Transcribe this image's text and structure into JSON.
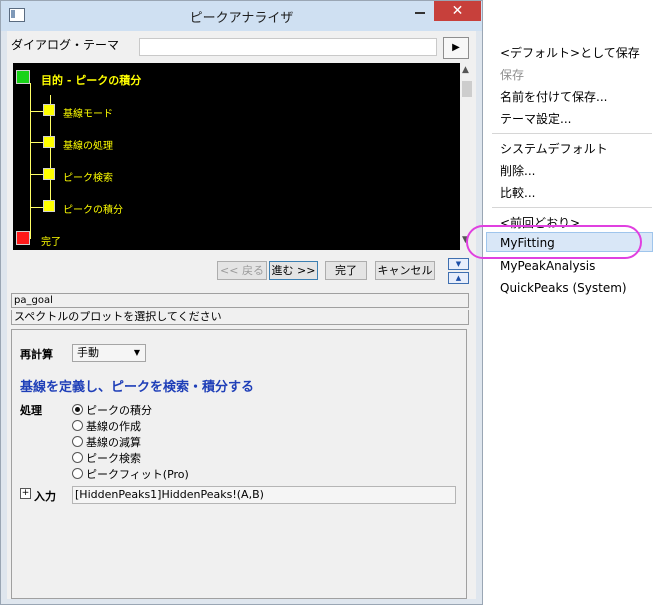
{
  "window": {
    "title": "ピークアナライザ",
    "close_symbol": "✕"
  },
  "dialog_theme": {
    "label": "ダイアログ・テーマ",
    "value": "",
    "arrow": "▶"
  },
  "flowchart": {
    "goal": "目的 - ピークの積分",
    "steps": [
      "基線モード",
      "基線の処理",
      "ピーク検索",
      "ピークの積分"
    ],
    "finish": "完了"
  },
  "nav": {
    "back": "<< 戻る",
    "next": "進む >>",
    "finish": "完了",
    "cancel": "キャンセル",
    "up_arrow": "▲",
    "down_arrow": "▼"
  },
  "page": {
    "name": "pa_goal",
    "description": "スペクトルのプロットを選択してください"
  },
  "settings": {
    "recalc_label": "再計算",
    "recalc_value": "手動",
    "heading": "基線を定義し、ピークを検索・積分する",
    "process_label": "処理",
    "options": [
      "ピークの積分",
      "基線の作成",
      "基線の減算",
      "ピーク検索",
      "ピークフィット(Pro)"
    ],
    "selected_index": 0,
    "input_label": "入力",
    "input_value": "[HiddenPeaks1]HiddenPeaks!(A,B)"
  },
  "menu": {
    "items": [
      {
        "label": "<デフォルト>として保存",
        "enabled": true
      },
      {
        "label": "保存",
        "enabled": false
      },
      {
        "label": "名前を付けて保存...",
        "enabled": true
      },
      {
        "label": "テーマ設定...",
        "enabled": true
      },
      {
        "label": "システムデフォルト",
        "enabled": true
      },
      {
        "label": "削除...",
        "enabled": true
      },
      {
        "label": "比較...",
        "enabled": true
      },
      {
        "label": "<前回どおり>",
        "enabled": true
      },
      {
        "label": "MyFitting",
        "enabled": true,
        "highlighted": true
      },
      {
        "label": "MyPeakAnalysis",
        "enabled": true
      },
      {
        "label": "QuickPeaks (System)",
        "enabled": true
      }
    ]
  },
  "colors": {
    "flow_background": "#000000",
    "flow_text": "#ffff00",
    "node_start": "#18d318",
    "node_step": "#ffff00",
    "node_finish": "#ff1a1a",
    "heading_blue": "#1f3fb8",
    "highlight_ring": "#e040e0"
  }
}
